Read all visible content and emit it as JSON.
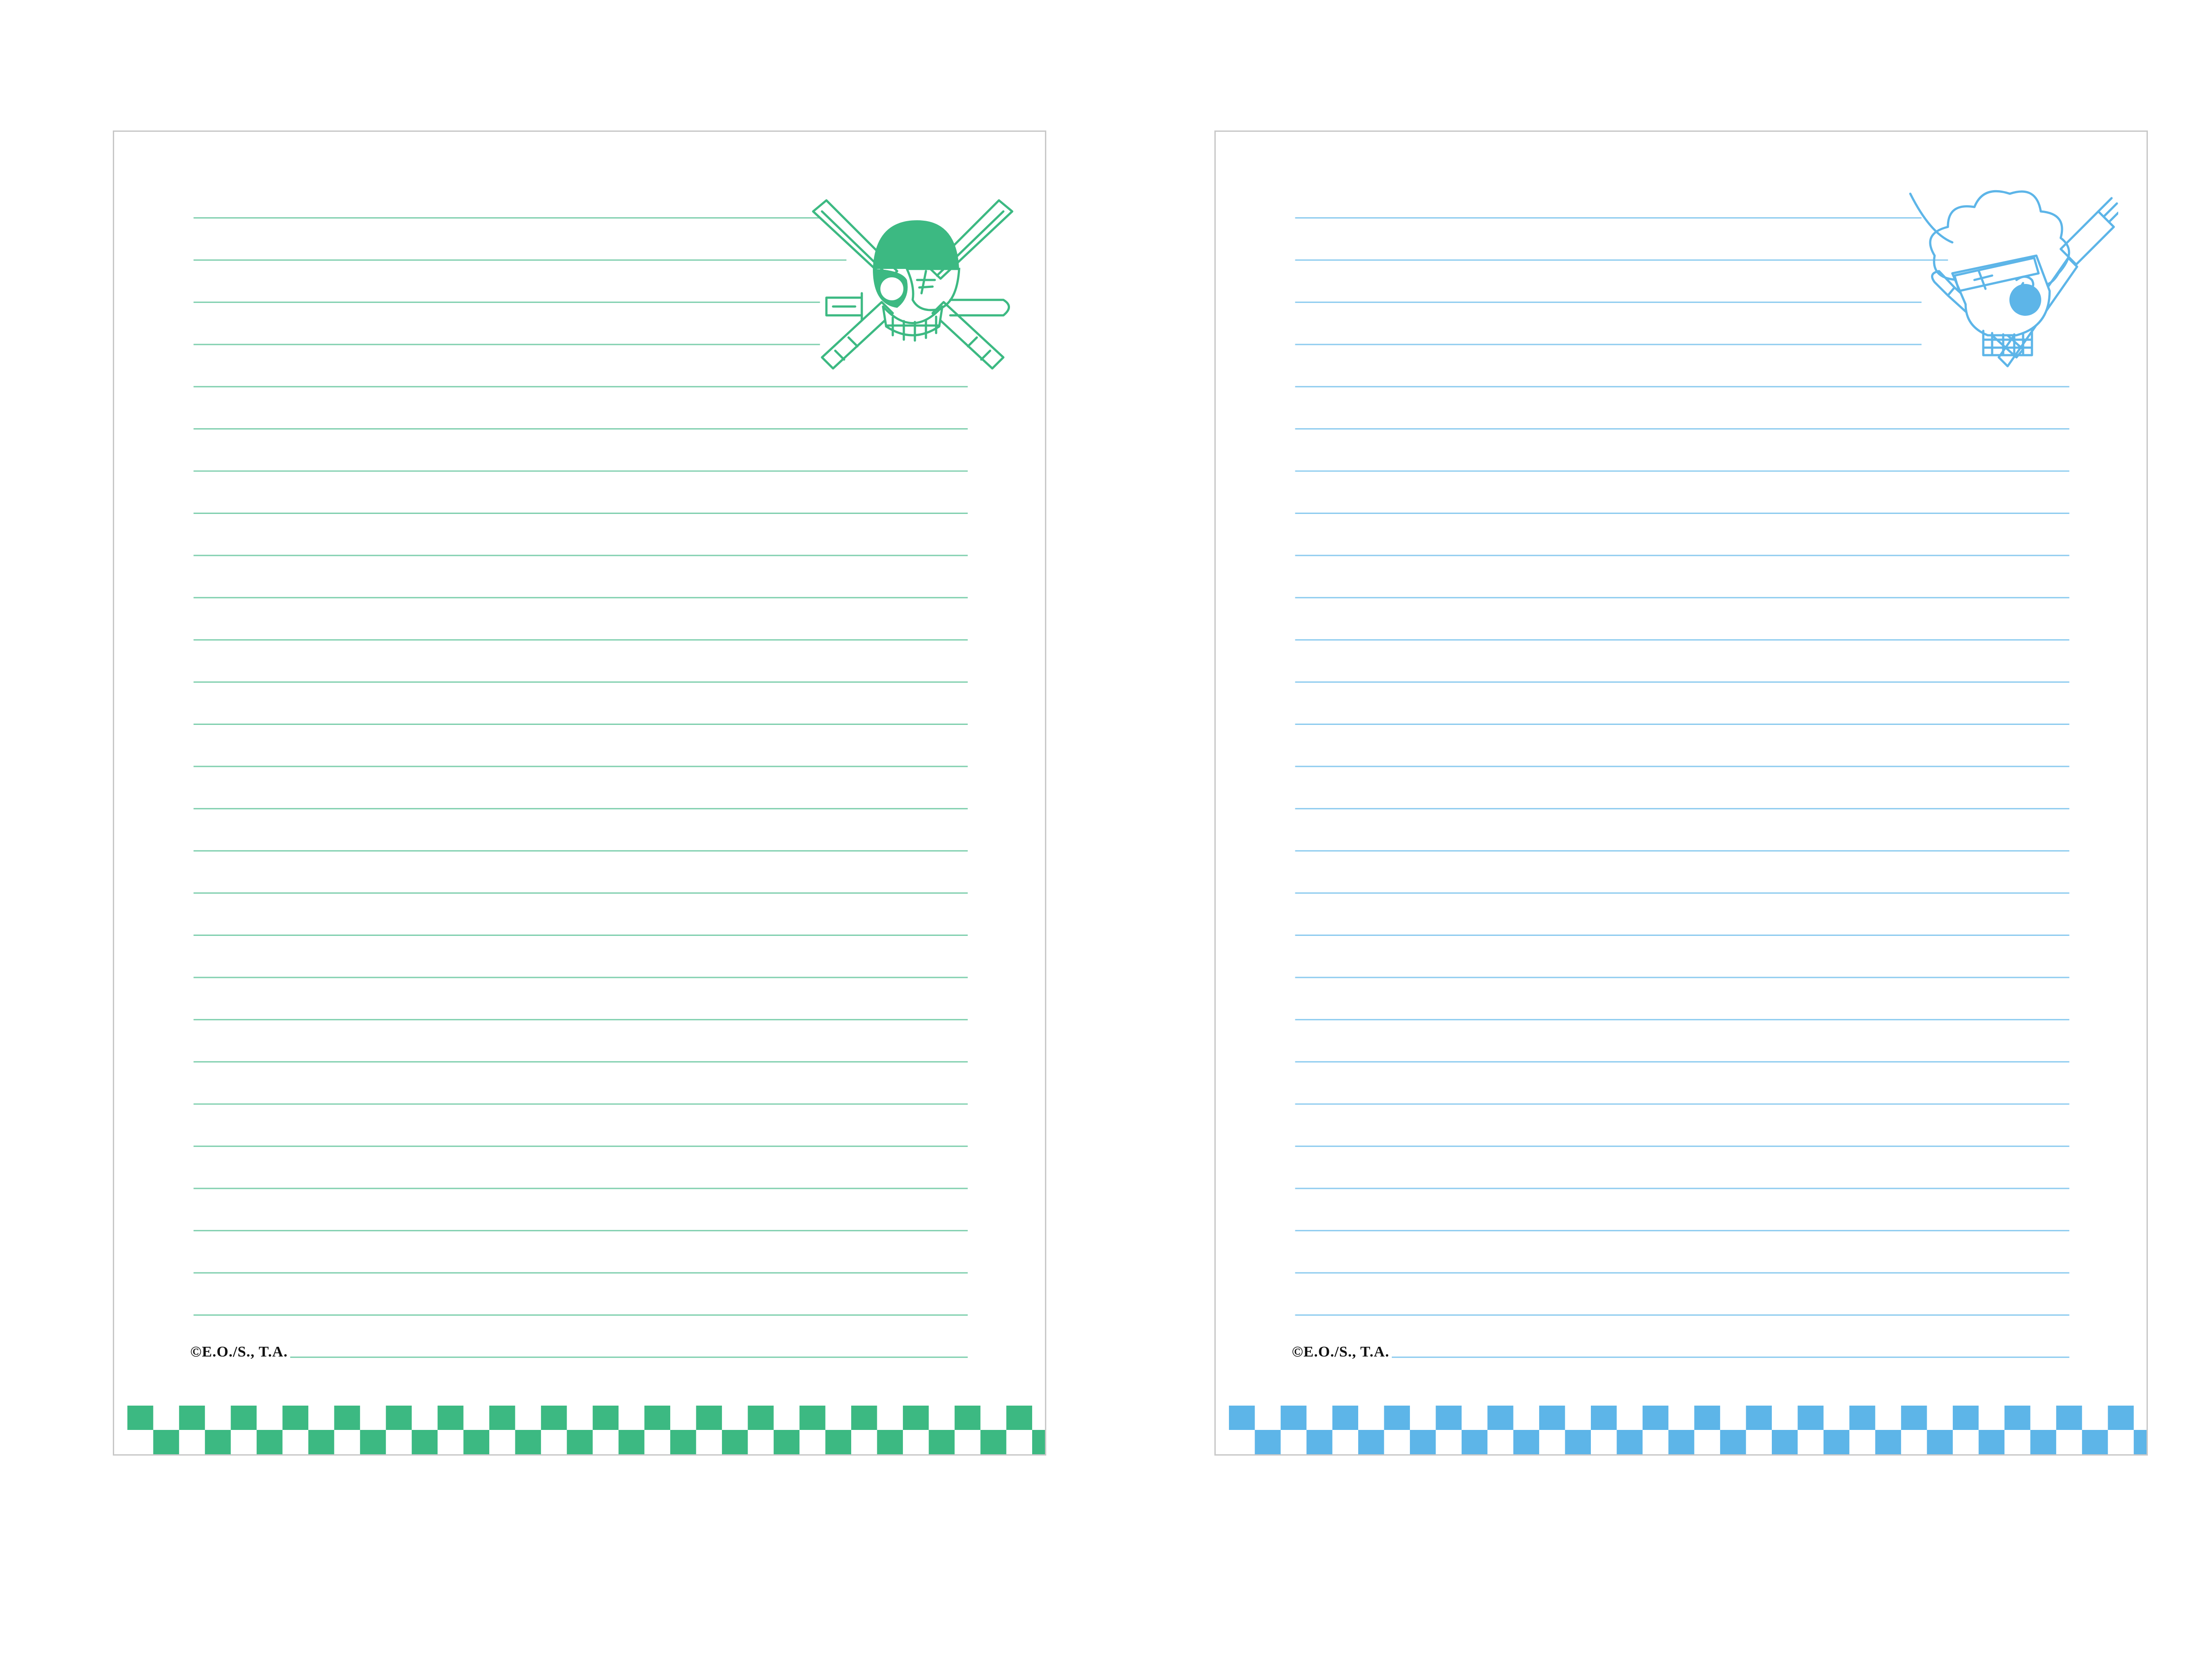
{
  "sheets": [
    {
      "id": "left",
      "theme": "zoro",
      "accent": "#3cb982",
      "line_color": "#7fcfae",
      "emblem_icon": "swordsman-skull-jolly-roger-icon",
      "copyright": "©E.O./S., T.A."
    },
    {
      "id": "right",
      "theme": "sanji",
      "accent": "#5db5e8",
      "line_color": "#8ccbef",
      "emblem_icon": "cook-skull-jolly-roger-icon",
      "copyright": "©E.O./S., T.A."
    }
  ]
}
